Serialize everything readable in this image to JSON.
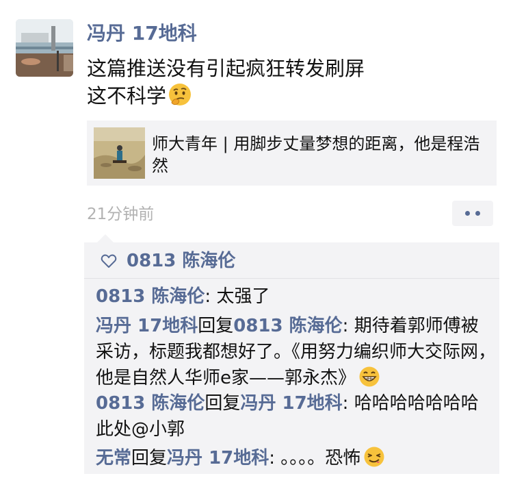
{
  "post": {
    "author": "冯丹 17地科",
    "text_lines": [
      "这篇推送没有引起疯狂转发刷屏",
      "这不科学"
    ],
    "emoji": "thinking-face-icon",
    "share": {
      "title": "师大青年 | 用脚步丈量梦想的距离，他是程浩然"
    },
    "timestamp": "21分钟前"
  },
  "likes": {
    "names": "0813 陈海伦"
  },
  "comments": [
    {
      "user": "0813 陈海伦",
      "sep": ": ",
      "text": "太强了"
    },
    {
      "user": "冯丹 17地科",
      "reply_word": "回复",
      "reply_to": "0813 陈海伦",
      "sep": ": ",
      "text": "期待着郭师傅被采访，标题我都想好了。《用努力编织师大交际网，他是自然人华师e家——郭永杰》",
      "emoji": "grinning-face-icon"
    },
    {
      "user": "0813 陈海伦",
      "reply_word": "回复",
      "reply_to": "冯丹 17地科",
      "sep": ": ",
      "text": "哈哈哈哈哈哈哈此处@小郭"
    },
    {
      "user": "无常",
      "reply_word": "回复",
      "reply_to": "冯丹 17地科",
      "sep": ": ",
      "text": "。。。。恐怖",
      "emoji": "smirking-squint-face-icon"
    }
  ],
  "colors": {
    "link_blue": "#576b95",
    "panel_gray": "#f3f3f5",
    "time_gray": "#b2b2b2"
  }
}
